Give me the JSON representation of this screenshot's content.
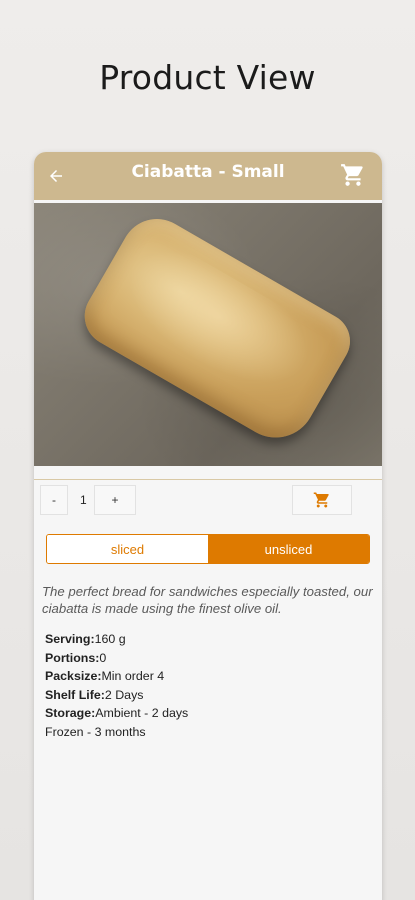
{
  "page": {
    "heading": "Product View"
  },
  "appbar": {
    "title": "Ciabatta - Small",
    "back_icon": "arrow-left-icon",
    "cart_icon": "cart-icon"
  },
  "quantity": {
    "minus": "-",
    "value": "1",
    "plus": "+"
  },
  "options": {
    "sliced": "sliced",
    "unsliced": "unsliced",
    "selected": "unsliced"
  },
  "description": "The perfect bread for sandwiches especially toasted, our ciabatta is made using the finest olive oil.",
  "specs": {
    "serving_label": "Serving:",
    "serving_value": "160 g",
    "portions_label": "Portions:",
    "portions_value": "0",
    "packsize_label": "Packsize:",
    "packsize_value": "Min order 4",
    "shelf_label": "Shelf Life:",
    "shelf_value": "2 Days",
    "storage_label": "Storage:",
    "storage_value": "Ambient - 2 days",
    "storage_value_2": "Frozen - 3 months"
  },
  "colors": {
    "appbar": "#cdb88f",
    "accent": "#de7a00"
  }
}
